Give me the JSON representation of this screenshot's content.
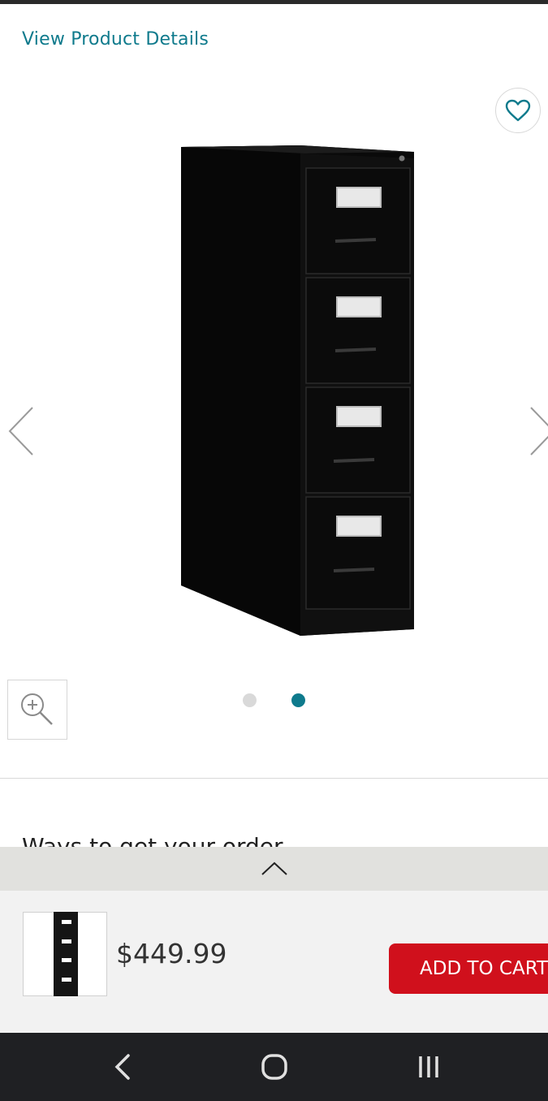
{
  "header": {
    "view_details_link": "View Product Details"
  },
  "gallery": {
    "favorite_icon": "heart-icon",
    "prev_icon": "chevron-left-icon",
    "next_icon": "chevron-right-icon",
    "zoom_icon": "zoom-in-icon",
    "current_index": 2,
    "total_images": 2,
    "active_dot_color": "#0e7a8c",
    "inactive_dot_color": "#d9d9d9"
  },
  "section": {
    "heading": "Ways to get your order"
  },
  "bottom_bar": {
    "expand_icon": "chevron-up-icon",
    "price": "$449.99",
    "add_to_cart_label": "ADD TO CART",
    "button_color": "#d0101c"
  },
  "system_nav": {
    "back_icon": "back-icon",
    "home_icon": "home-icon",
    "recents_icon": "recents-icon"
  },
  "colors": {
    "accent": "#0e7a8c",
    "cart_red": "#d0101c"
  }
}
